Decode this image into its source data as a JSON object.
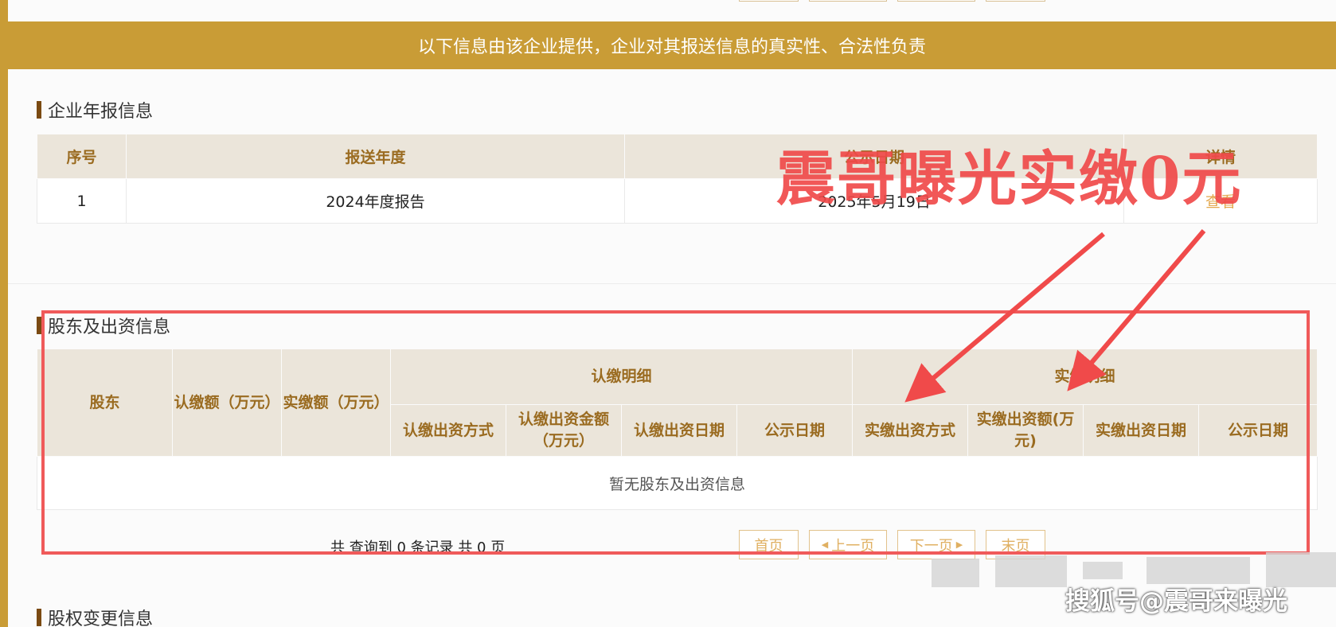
{
  "banner": {
    "text": "以下信息由该企业提供，企业对其报送信息的真实性、合法性负责"
  },
  "annual_report": {
    "title": "企业年报信息",
    "headers": [
      "序号",
      "报送年度",
      "公示日期",
      "详情"
    ],
    "rows": [
      {
        "index": "1",
        "year": "2024年度报告",
        "date": "2025年5月19日",
        "detail": "查看"
      }
    ]
  },
  "shareholders": {
    "title": "股东及出资信息",
    "headers": {
      "shareholder": "股东",
      "subscribed": "认缴额（万元）",
      "paid": "实缴额（万元）",
      "subscribed_detail": "认缴明细",
      "paid_detail": "实缴明细",
      "sub_method": "认缴出资方式",
      "sub_amount": "认缴出资金额（万元）",
      "sub_date": "认缴出资日期",
      "sub_pub_date": "公示日期",
      "paid_method": "实缴出资方式",
      "paid_amount": "实缴出资额(万元)",
      "paid_date": "实缴出资日期",
      "paid_pub_date": "公示日期"
    },
    "empty_text": "暂无股东及出资信息"
  },
  "pager": {
    "info": "共 查询到 0 条记录 共 0 页",
    "first": "首页",
    "prev": "上一页",
    "next": "下一页",
    "last": "末页"
  },
  "equity_change": {
    "title": "股权变更信息"
  },
  "overlay": {
    "headline": "震哥曝光实缴0元",
    "watermark": "搜狐号@震哥来曝光"
  },
  "colors": {
    "gold": "#c99c36",
    "header_bg": "#ebe5da",
    "header_text": "#9a6b20",
    "annotation_red": "#f04a4a"
  }
}
